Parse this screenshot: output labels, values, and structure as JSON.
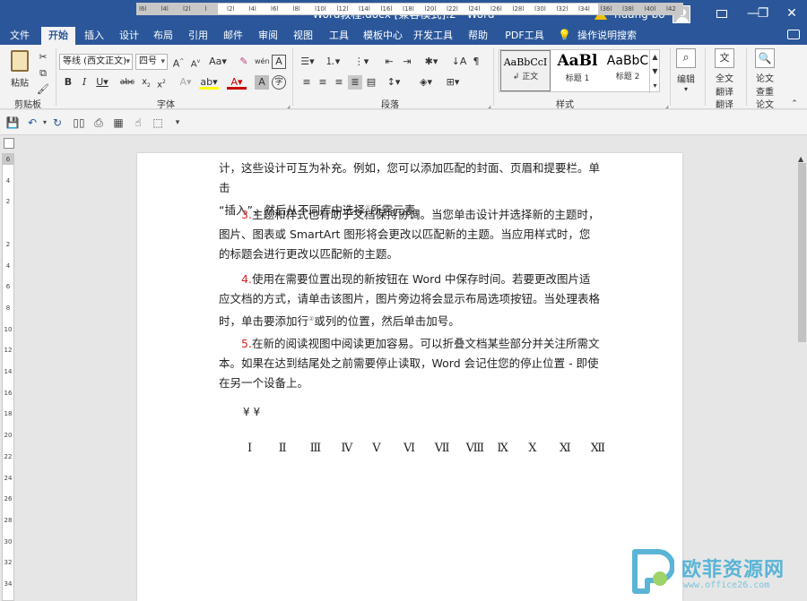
{
  "window": {
    "title": "Word教程.docx [兼容模式]:2  -  Word",
    "user_name": "huang bo",
    "minimize": "—",
    "restore": "❐",
    "close": "✕"
  },
  "tabs": [
    "文件",
    "开始",
    "插入",
    "设计",
    "布局",
    "引用",
    "邮件",
    "审阅",
    "视图",
    "工具",
    "模板中心",
    "开发工具",
    "帮助",
    "PDF工具集",
    "操作说明搜索"
  ],
  "active_tab": "开始",
  "ribbon": {
    "clipboard": {
      "paste_label": "粘贴",
      "group_label": "剪贴板"
    },
    "font": {
      "font_name": "等线 (西文正文)",
      "font_size": "四号",
      "group_label": "字体"
    },
    "paragraph": {
      "group_label": "段落"
    },
    "styles": {
      "group_label": "样式",
      "items": [
        {
          "sample": "AaBbCcI",
          "name": "↲ 正文"
        },
        {
          "sample": "AaBl",
          "name": "标题 1"
        },
        {
          "sample": "AaBbC",
          "name": "标题 2"
        }
      ]
    },
    "editing": {
      "label": "编辑"
    },
    "translate": {
      "label_line1": "全文",
      "label_line2": "翻译",
      "group_label": "翻译"
    },
    "paper": {
      "label_line1": "论文",
      "label_line2": "查重",
      "group_label": "论文"
    }
  },
  "ruler": {
    "h_ticks": [
      "l6l",
      "l4l",
      "l2l",
      "l",
      "l2l",
      "l4l",
      "l6l",
      "l8l",
      "l10l",
      "l12l",
      "l14l",
      "l16l",
      "l18l",
      "l20l",
      "l22l",
      "l24l",
      "l26l",
      "l28l",
      "l30l",
      "l32l",
      "l34l",
      "l36l",
      "l38l",
      "l40l",
      "l42"
    ],
    "v_ticks": [
      "6",
      "4",
      "2",
      "",
      "2",
      "4",
      "6",
      "8",
      "10",
      "12",
      "14",
      "16",
      "18",
      "20",
      "22",
      "24",
      "26",
      "28",
      "30",
      "32",
      "34"
    ]
  },
  "document": {
    "para1_line1": "计，这些设计可互为补充。例如，您可以添加匹配的封面、页眉和提要栏。单击",
    "para1_line2a": "“插入”，然后从不同库中选择",
    "para1_sup": "①",
    "para1_line2b": "所需元素。",
    "para2_num": "3.",
    "para2_text": "主题和样式也有助于文档保持协调。当您单击设计并选择新的主题时，图片、图表或 SmartArt 图形将会更改以匹配新的主题。当应用样式时，您的标题会进行更改以匹配新的主题。",
    "para3_num": "4.",
    "para3_text_a": "使用在需要位置出现的新按钮在 Word 中保存时间。若要更改图片适应文档的方式，请单击该图片，图片旁边将会显示布局选项按钮。当处理表格时，单击要添加行",
    "para3_sup": "②",
    "para3_text_b": "或列的位置，然后单击加号。",
    "para4_num": "5.",
    "para4_text": "在新的阅读视图中阅读更加容易。可以折叠文档某些部分并关注所需文本。如果在达到结尾处之前需要停止读取，Word 会记住您的停止位置 - 即使在另一个设备上。",
    "yen": "¥  ¥",
    "roman": [
      "Ⅰ",
      "Ⅱ",
      "Ⅲ",
      "Ⅳ",
      "Ⅴ",
      "Ⅵ",
      "Ⅶ",
      "Ⅷ",
      "Ⅸ",
      "Ⅹ",
      "Ⅺ",
      "Ⅻ"
    ]
  },
  "watermark": {
    "text": "欧菲资源网",
    "url": "www.office26.com"
  },
  "colors": {
    "accent": "#2b579a",
    "number_red": "#d42424",
    "watermark": "#5ab4d6"
  }
}
